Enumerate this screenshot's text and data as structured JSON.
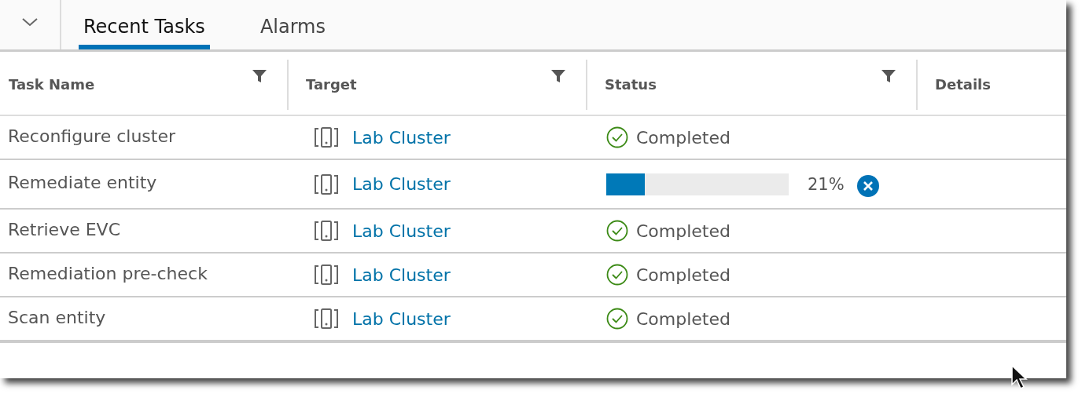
{
  "tabs": [
    {
      "label": "Recent Tasks",
      "selected": true
    },
    {
      "label": "Alarms",
      "selected": false
    }
  ],
  "table": {
    "columns": [
      {
        "label": "Task Name",
        "filter": true
      },
      {
        "label": "Target",
        "filter": true
      },
      {
        "label": "Status",
        "filter": true
      },
      {
        "label": "Details",
        "filter": false
      }
    ],
    "rows": [
      {
        "task": "Reconfigure cluster",
        "target": "Lab Cluster",
        "status": {
          "kind": "completed",
          "text": "Completed"
        }
      },
      {
        "task": "Remediate entity",
        "target": "Lab Cluster",
        "status": {
          "kind": "progress",
          "level": 0.21,
          "text": "21%"
        }
      },
      {
        "task": "Retrieve EVC",
        "target": "Lab Cluster",
        "status": {
          "kind": "completed",
          "text": "Completed"
        }
      },
      {
        "task": "Remediation pre-check",
        "target": "Lab Cluster",
        "status": {
          "kind": "completed",
          "text": "Completed"
        }
      },
      {
        "task": "Scan entity",
        "target": "Lab Cluster",
        "status": {
          "kind": "completed",
          "text": "Completed"
        }
      }
    ]
  }
}
